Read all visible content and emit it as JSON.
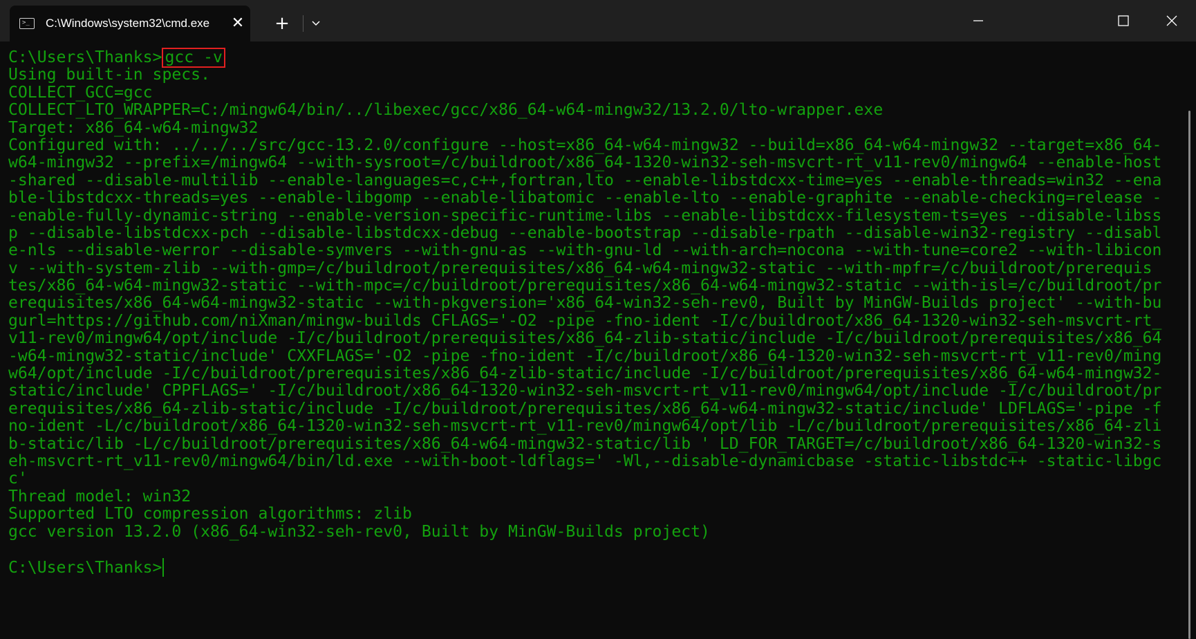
{
  "titlebar": {
    "tab_title": "C:\\Windows\\system32\\cmd.exe",
    "tab_close_glyph": "✕",
    "new_tab_glyph": "+",
    "icons": [
      "terminal-icon",
      "close-icon",
      "plus-icon",
      "chevron-down-icon",
      "minimize-icon",
      "maximize-icon",
      "close-window-icon"
    ]
  },
  "terminal": {
    "prompt": "C:\\Users\\Thanks>",
    "command": "gcc -v",
    "output_lines": [
      "Using built-in specs.",
      "COLLECT_GCC=gcc",
      "COLLECT_LTO_WRAPPER=C:/mingw64/bin/../libexec/gcc/x86_64-w64-mingw32/13.2.0/lto-wrapper.exe",
      "Target: x86_64-w64-mingw32",
      "Configured with: ../../../src/gcc-13.2.0/configure --host=x86_64-w64-mingw32 --build=x86_64-w64-mingw32 --target=x86_64-",
      "w64-mingw32 --prefix=/mingw64 --with-sysroot=/c/buildroot/x86_64-1320-win32-seh-msvcrt-rt_v11-rev0/mingw64 --enable-host",
      "-shared --disable-multilib --enable-languages=c,c++,fortran,lto --enable-libstdcxx-time=yes --enable-threads=win32 --ena",
      "ble-libstdcxx-threads=yes --enable-libgomp --enable-libatomic --enable-lto --enable-graphite --enable-checking=release -",
      "-enable-fully-dynamic-string --enable-version-specific-runtime-libs --enable-libstdcxx-filesystem-ts=yes --disable-libss",
      "p --disable-libstdcxx-pch --disable-libstdcxx-debug --enable-bootstrap --disable-rpath --disable-win32-registry --disabl",
      "e-nls --disable-werror --disable-symvers --with-gnu-as --with-gnu-ld --with-arch=nocona --with-tune=core2 --with-libicon",
      "v --with-system-zlib --with-gmp=/c/buildroot/prerequisites/x86_64-w64-mingw32-static --with-mpfr=/c/buildroot/prerequis",
      "tes/x86_64-w64-mingw32-static --with-mpc=/c/buildroot/prerequisites/x86_64-w64-mingw32-static --with-isl=/c/buildroot/pr",
      "erequisites/x86_64-w64-mingw32-static --with-pkgversion='x86_64-win32-seh-rev0, Built by MinGW-Builds project' --with-bu",
      "gurl=https://github.com/niXman/mingw-builds CFLAGS='-O2 -pipe -fno-ident -I/c/buildroot/x86_64-1320-win32-seh-msvcrt-rt_",
      "v11-rev0/mingw64/opt/include -I/c/buildroot/prerequisites/x86_64-zlib-static/include -I/c/buildroot/prerequisites/x86_64",
      "-w64-mingw32-static/include' CXXFLAGS='-O2 -pipe -fno-ident -I/c/buildroot/x86_64-1320-win32-seh-msvcrt-rt_v11-rev0/ming",
      "w64/opt/include -I/c/buildroot/prerequisites/x86_64-zlib-static/include -I/c/buildroot/prerequisites/x86_64-w64-mingw32-",
      "static/include' CPPFLAGS=' -I/c/buildroot/x86_64-1320-win32-seh-msvcrt-rt_v11-rev0/mingw64/opt/include -I/c/buildroot/pr",
      "erequisites/x86_64-zlib-static/include -I/c/buildroot/prerequisites/x86_64-w64-mingw32-static/include' LDFLAGS='-pipe -f",
      "no-ident -L/c/buildroot/x86_64-1320-win32-seh-msvcrt-rt_v11-rev0/mingw64/opt/lib -L/c/buildroot/prerequisites/x86_64-zli",
      "b-static/lib -L/c/buildroot/prerequisites/x86_64-w64-mingw32-static/lib ' LD_FOR_TARGET=/c/buildroot/x86_64-1320-win32-s",
      "eh-msvcrt-rt_v11-rev0/mingw64/bin/ld.exe --with-boot-ldflags=' -Wl,--disable-dynamicbase -static-libstdc++ -static-libgc",
      "c'",
      "Thread model: win32",
      "Supported LTO compression algorithms: zlib",
      "gcc version 13.2.0 (x86_64-win32-seh-rev0, Built by MinGW-Builds project)"
    ],
    "final_prompt": "C:\\Users\\Thanks>"
  },
  "colors": {
    "terminal_bg": "#0c0c0c",
    "text": "#13a10e",
    "titlebar_bg": "#202020",
    "highlight_box": "#e32020"
  }
}
